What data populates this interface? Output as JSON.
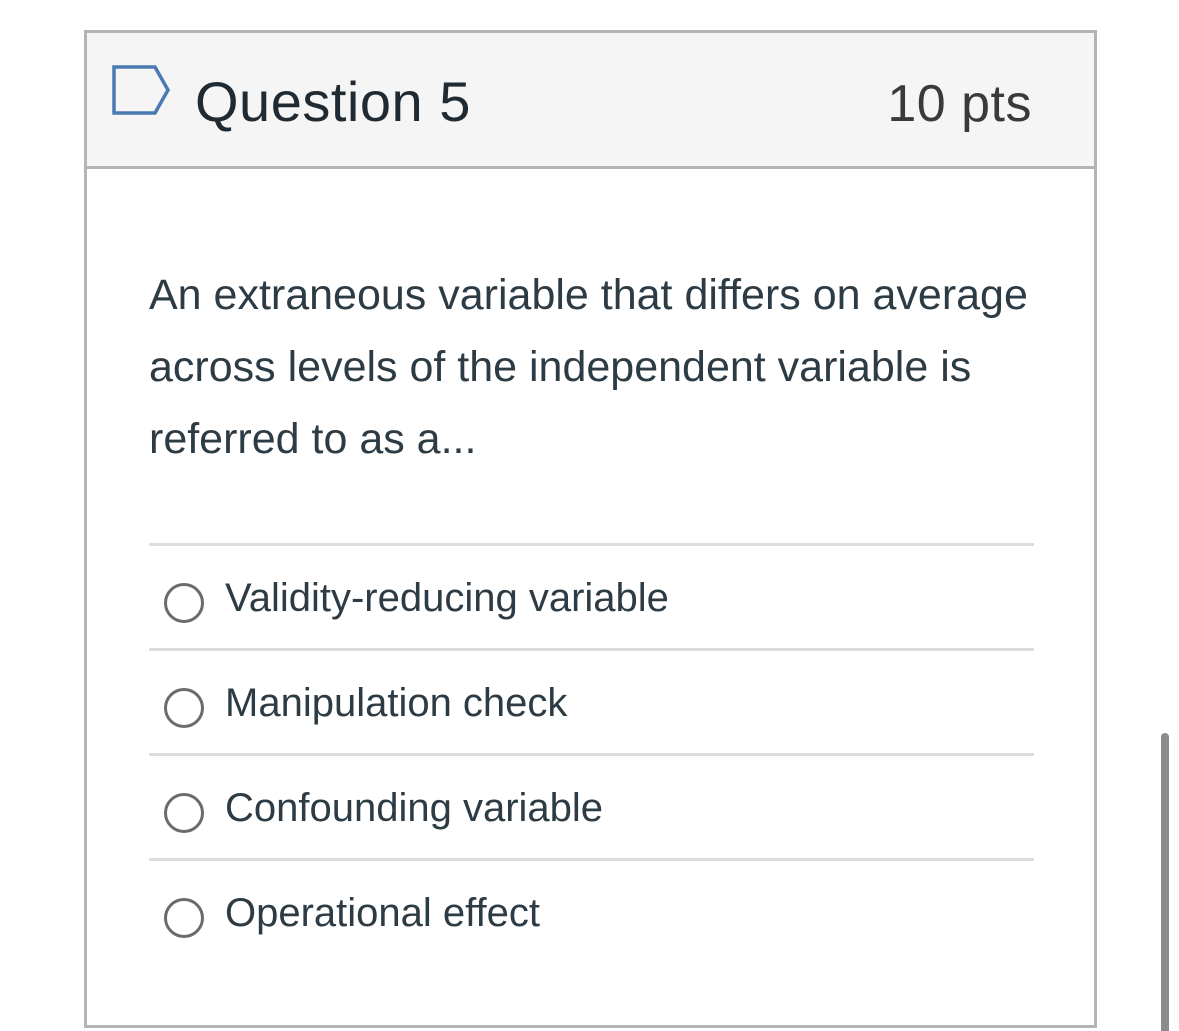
{
  "question": {
    "title": "Question 5",
    "points": "10 pts",
    "flag_icon": "flag-icon",
    "text": "An extraneous variable that differs on average across levels of the independent variable is referred to as a...",
    "answers": [
      {
        "label": "Validity-reducing variable",
        "selected": false
      },
      {
        "label": "Manipulation check",
        "selected": false
      },
      {
        "label": "Confounding variable",
        "selected": false
      },
      {
        "label": "Operational effect",
        "selected": false
      }
    ]
  },
  "colors": {
    "header_bg": "#f5f5f5",
    "border": "#b4b4b4",
    "divider": "#dcdcdc",
    "flag_outline": "#4a7ab2",
    "text": "#2d3b45"
  }
}
